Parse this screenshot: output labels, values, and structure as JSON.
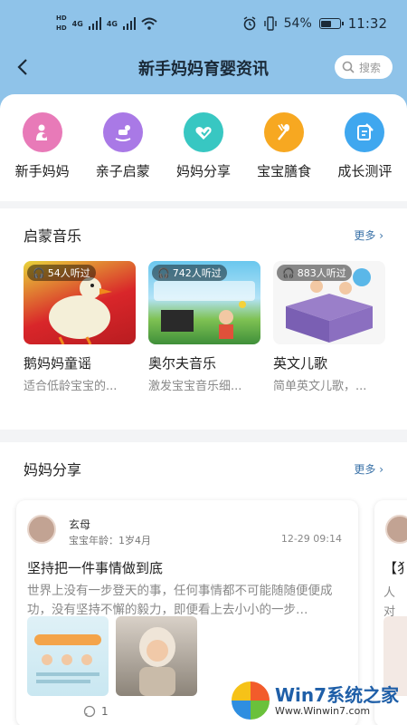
{
  "status": {
    "time": "11:32",
    "battery": "54%",
    "battery_level": 0.54,
    "sim1": "HD",
    "sim2": "HD",
    "net": "4G"
  },
  "nav": {
    "title": "新手妈妈育婴资讯",
    "search_placeholder": "搜索",
    "back_icon": "chevron-left-icon"
  },
  "categories": [
    {
      "label": "新手妈妈",
      "icon": "mother-icon",
      "color": "#e87ab8"
    },
    {
      "label": "亲子启蒙",
      "icon": "rocking-horse-icon",
      "color": "#a979e6"
    },
    {
      "label": "妈妈分享",
      "icon": "share-heart-icon",
      "color": "#38c7c2"
    },
    {
      "label": "宝宝膳食",
      "icon": "spoon-fork-icon",
      "color": "#f7a821"
    },
    {
      "label": "成长测评",
      "icon": "edit-note-icon",
      "color": "#3fa7ef"
    }
  ],
  "music": {
    "title": "启蒙音乐",
    "more": "更多 ›",
    "items": [
      {
        "listens": "54人听过",
        "title": "鹅妈妈童谣",
        "subtitle": "适合低龄宝宝的..."
      },
      {
        "listens": "742人听过",
        "title": "奥尔夫音乐",
        "subtitle": "激发宝宝音乐细..."
      },
      {
        "listens": "883人听过",
        "title": "英文儿歌",
        "subtitle": "简单英文儿歌，..."
      }
    ]
  },
  "share": {
    "title": "妈妈分享",
    "more": "更多 ›",
    "post": {
      "user": "玄母",
      "baby_age": "宝宝年龄：1岁4月",
      "date": "12-29 09:14",
      "title": "坚持把一件事情做到底",
      "body": "世界上没有一步登天的事，任何事情都不可能随随便便成功，没有坚持不懈的毅力，即便看上去小小的一步…",
      "comments": "1"
    },
    "peek": {
      "title_fragment": "【犭",
      "body_fragment": "人对化，"
    }
  },
  "watermark": {
    "brand": "Win7系统之家",
    "url": "Www.Winwin7.com"
  }
}
